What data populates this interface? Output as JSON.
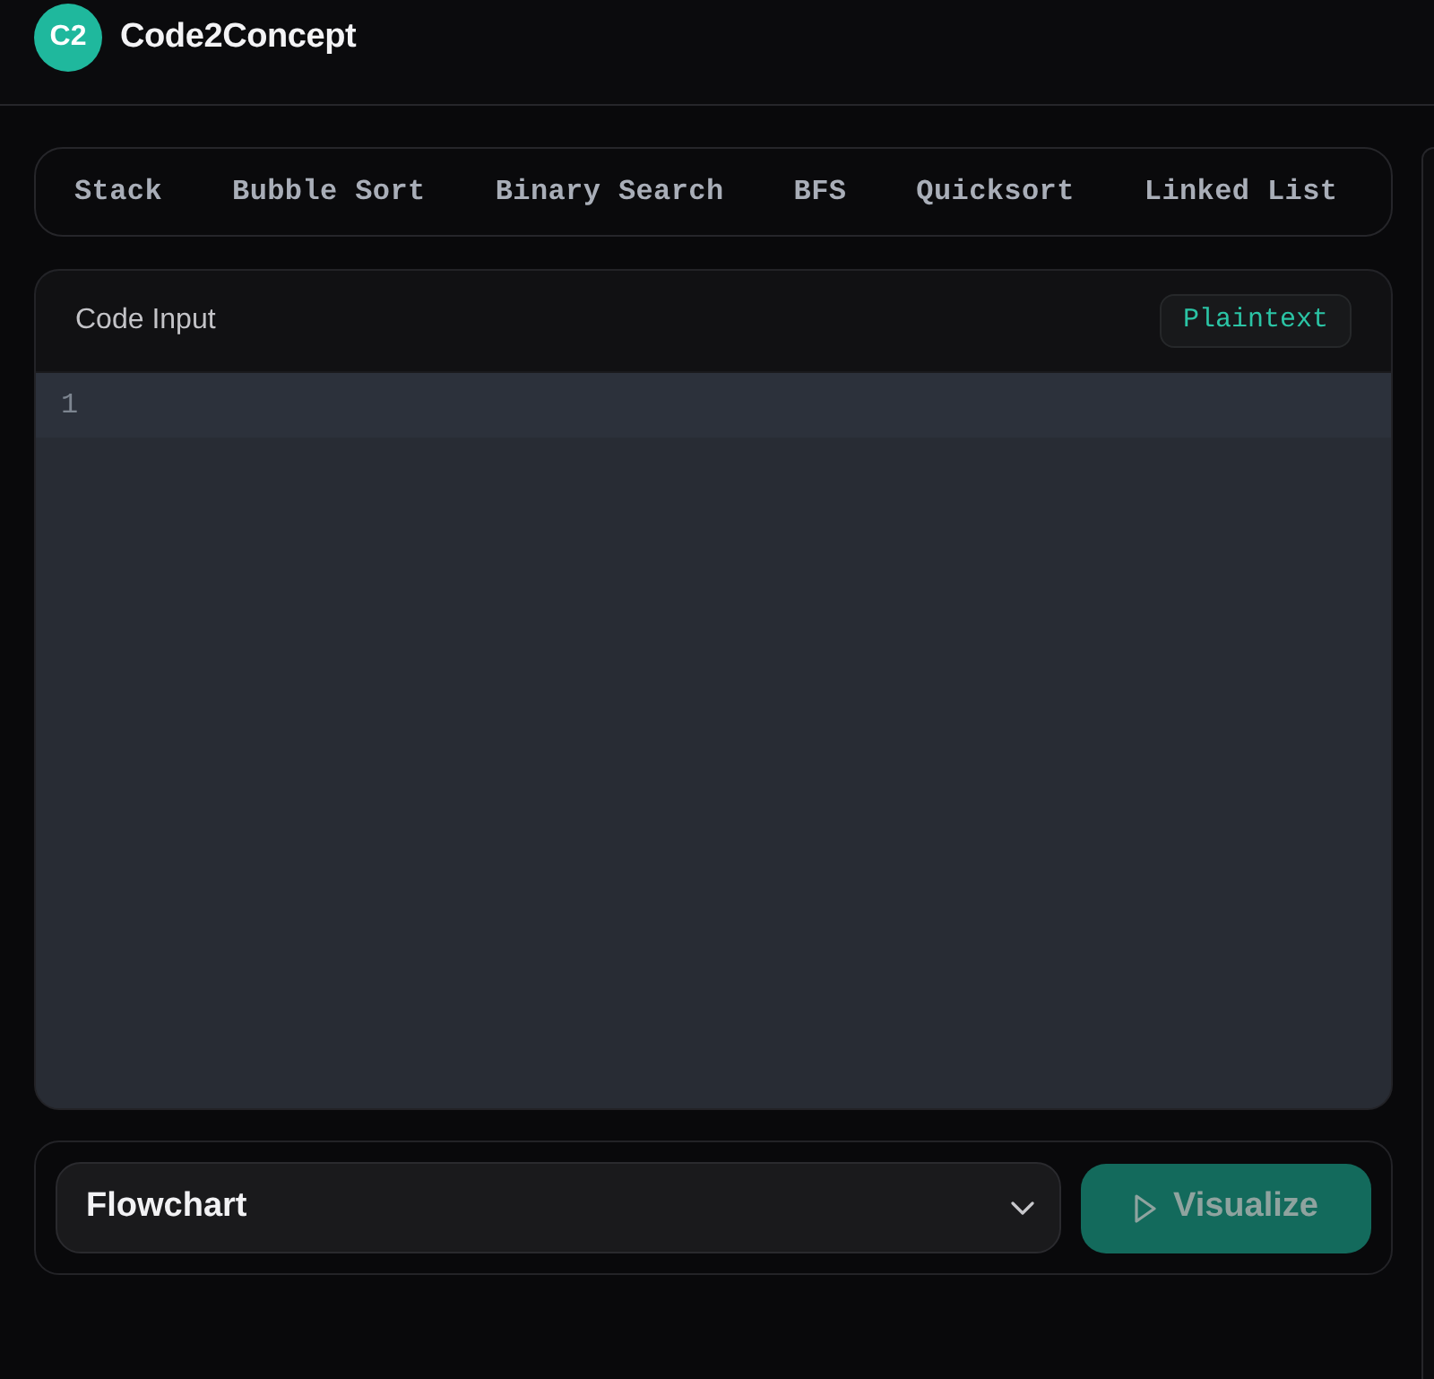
{
  "header": {
    "logo": "C2",
    "title": "Code2Concept"
  },
  "examples": [
    {
      "label": "Stack",
      "selected": false
    },
    {
      "label": "Bubble Sort",
      "selected": false
    },
    {
      "label": "Binary Search",
      "selected": false
    },
    {
      "label": "BFS",
      "selected": false
    },
    {
      "label": "Quicksort",
      "selected": false
    },
    {
      "label": "Linked List",
      "selected": false
    }
  ],
  "editor": {
    "title": "Code Input",
    "language": "Plaintext",
    "lines": [
      {
        "number": "1",
        "active": true
      }
    ]
  },
  "controls": {
    "diagram_type": "Flowchart",
    "visualize": {
      "label": "Visualize",
      "disabled": true
    }
  }
}
